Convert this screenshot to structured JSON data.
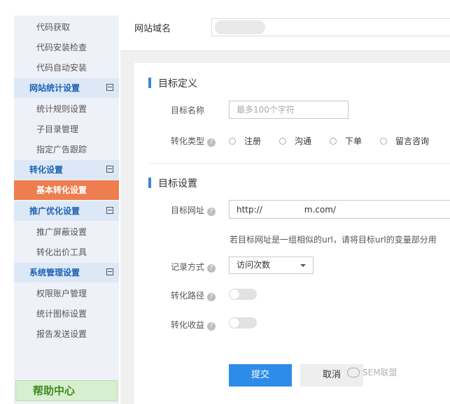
{
  "sidebar": {
    "items": [
      {
        "label": "代码获取",
        "type": "item"
      },
      {
        "label": "代码安装检查",
        "type": "item"
      },
      {
        "label": "代码自动安装",
        "type": "item"
      },
      {
        "label": "网站统计设置",
        "type": "group"
      },
      {
        "label": "统计规则设置",
        "type": "item"
      },
      {
        "label": "子目录管理",
        "type": "item"
      },
      {
        "label": "指定广告跟踪",
        "type": "item"
      },
      {
        "label": "转化设置",
        "type": "group"
      },
      {
        "label": "基本转化设置",
        "type": "active"
      },
      {
        "label": "推广优化设置",
        "type": "group"
      },
      {
        "label": "推广屏蔽设置",
        "type": "item"
      },
      {
        "label": "转化出价工具",
        "type": "item"
      },
      {
        "label": "系统管理设置",
        "type": "group"
      },
      {
        "label": "权限账户管理",
        "type": "item"
      },
      {
        "label": "统计图标设置",
        "type": "item"
      },
      {
        "label": "报告发送设置",
        "type": "item"
      }
    ],
    "help": "帮助中心"
  },
  "header": {
    "domain_label": "网站域名"
  },
  "section1": {
    "title": "目标定义",
    "name_label": "目标名称",
    "name_placeholder": "最多100个字符",
    "type_label": "转化类型",
    "types": [
      "注册",
      "沟通",
      "下单",
      "留言咨询"
    ]
  },
  "section2": {
    "title": "目标设置",
    "url_label": "目标网址",
    "url_value": "http://　　　　　m.com/",
    "hint": "若目标网址是一组相似的url，请将目标url的变量部分用",
    "record_label": "记录方式",
    "record_value": "访问次数",
    "path_label": "转化路径",
    "profit_label": "转化收益"
  },
  "actions": {
    "submit": "提交",
    "cancel": "取消"
  },
  "watermark": "SEM联盟",
  "help_glyph": "?",
  "colors": {
    "accent": "#2d8cea",
    "active_item": "#ee7d4f",
    "group_text": "#1f63b5",
    "help_green": "#3d8b1f"
  }
}
